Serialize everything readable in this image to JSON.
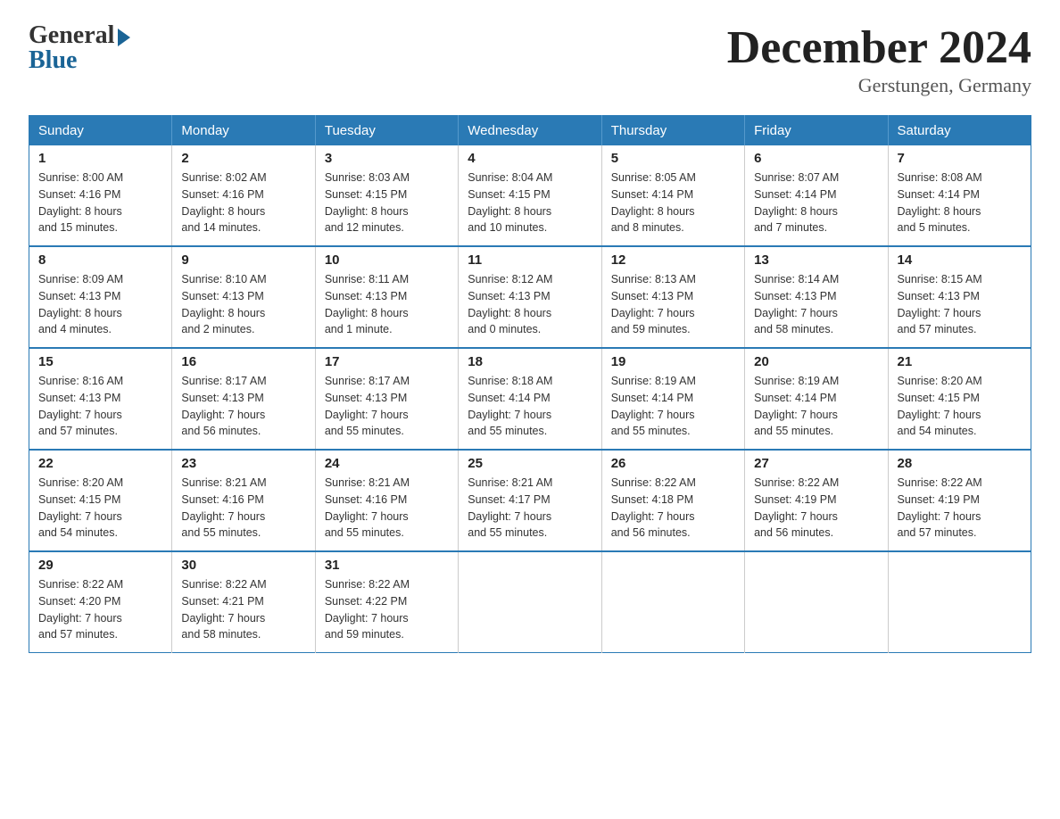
{
  "header": {
    "logo_general": "General",
    "logo_blue": "Blue",
    "month_title": "December 2024",
    "location": "Gerstungen, Germany"
  },
  "days_of_week": [
    "Sunday",
    "Monday",
    "Tuesday",
    "Wednesday",
    "Thursday",
    "Friday",
    "Saturday"
  ],
  "weeks": [
    [
      {
        "day": "1",
        "info": "Sunrise: 8:00 AM\nSunset: 4:16 PM\nDaylight: 8 hours\nand 15 minutes."
      },
      {
        "day": "2",
        "info": "Sunrise: 8:02 AM\nSunset: 4:16 PM\nDaylight: 8 hours\nand 14 minutes."
      },
      {
        "day": "3",
        "info": "Sunrise: 8:03 AM\nSunset: 4:15 PM\nDaylight: 8 hours\nand 12 minutes."
      },
      {
        "day": "4",
        "info": "Sunrise: 8:04 AM\nSunset: 4:15 PM\nDaylight: 8 hours\nand 10 minutes."
      },
      {
        "day": "5",
        "info": "Sunrise: 8:05 AM\nSunset: 4:14 PM\nDaylight: 8 hours\nand 8 minutes."
      },
      {
        "day": "6",
        "info": "Sunrise: 8:07 AM\nSunset: 4:14 PM\nDaylight: 8 hours\nand 7 minutes."
      },
      {
        "day": "7",
        "info": "Sunrise: 8:08 AM\nSunset: 4:14 PM\nDaylight: 8 hours\nand 5 minutes."
      }
    ],
    [
      {
        "day": "8",
        "info": "Sunrise: 8:09 AM\nSunset: 4:13 PM\nDaylight: 8 hours\nand 4 minutes."
      },
      {
        "day": "9",
        "info": "Sunrise: 8:10 AM\nSunset: 4:13 PM\nDaylight: 8 hours\nand 2 minutes."
      },
      {
        "day": "10",
        "info": "Sunrise: 8:11 AM\nSunset: 4:13 PM\nDaylight: 8 hours\nand 1 minute."
      },
      {
        "day": "11",
        "info": "Sunrise: 8:12 AM\nSunset: 4:13 PM\nDaylight: 8 hours\nand 0 minutes."
      },
      {
        "day": "12",
        "info": "Sunrise: 8:13 AM\nSunset: 4:13 PM\nDaylight: 7 hours\nand 59 minutes."
      },
      {
        "day": "13",
        "info": "Sunrise: 8:14 AM\nSunset: 4:13 PM\nDaylight: 7 hours\nand 58 minutes."
      },
      {
        "day": "14",
        "info": "Sunrise: 8:15 AM\nSunset: 4:13 PM\nDaylight: 7 hours\nand 57 minutes."
      }
    ],
    [
      {
        "day": "15",
        "info": "Sunrise: 8:16 AM\nSunset: 4:13 PM\nDaylight: 7 hours\nand 57 minutes."
      },
      {
        "day": "16",
        "info": "Sunrise: 8:17 AM\nSunset: 4:13 PM\nDaylight: 7 hours\nand 56 minutes."
      },
      {
        "day": "17",
        "info": "Sunrise: 8:17 AM\nSunset: 4:13 PM\nDaylight: 7 hours\nand 55 minutes."
      },
      {
        "day": "18",
        "info": "Sunrise: 8:18 AM\nSunset: 4:14 PM\nDaylight: 7 hours\nand 55 minutes."
      },
      {
        "day": "19",
        "info": "Sunrise: 8:19 AM\nSunset: 4:14 PM\nDaylight: 7 hours\nand 55 minutes."
      },
      {
        "day": "20",
        "info": "Sunrise: 8:19 AM\nSunset: 4:14 PM\nDaylight: 7 hours\nand 55 minutes."
      },
      {
        "day": "21",
        "info": "Sunrise: 8:20 AM\nSunset: 4:15 PM\nDaylight: 7 hours\nand 54 minutes."
      }
    ],
    [
      {
        "day": "22",
        "info": "Sunrise: 8:20 AM\nSunset: 4:15 PM\nDaylight: 7 hours\nand 54 minutes."
      },
      {
        "day": "23",
        "info": "Sunrise: 8:21 AM\nSunset: 4:16 PM\nDaylight: 7 hours\nand 55 minutes."
      },
      {
        "day": "24",
        "info": "Sunrise: 8:21 AM\nSunset: 4:16 PM\nDaylight: 7 hours\nand 55 minutes."
      },
      {
        "day": "25",
        "info": "Sunrise: 8:21 AM\nSunset: 4:17 PM\nDaylight: 7 hours\nand 55 minutes."
      },
      {
        "day": "26",
        "info": "Sunrise: 8:22 AM\nSunset: 4:18 PM\nDaylight: 7 hours\nand 56 minutes."
      },
      {
        "day": "27",
        "info": "Sunrise: 8:22 AM\nSunset: 4:19 PM\nDaylight: 7 hours\nand 56 minutes."
      },
      {
        "day": "28",
        "info": "Sunrise: 8:22 AM\nSunset: 4:19 PM\nDaylight: 7 hours\nand 57 minutes."
      }
    ],
    [
      {
        "day": "29",
        "info": "Sunrise: 8:22 AM\nSunset: 4:20 PM\nDaylight: 7 hours\nand 57 minutes."
      },
      {
        "day": "30",
        "info": "Sunrise: 8:22 AM\nSunset: 4:21 PM\nDaylight: 7 hours\nand 58 minutes."
      },
      {
        "day": "31",
        "info": "Sunrise: 8:22 AM\nSunset: 4:22 PM\nDaylight: 7 hours\nand 59 minutes."
      },
      {
        "day": "",
        "info": ""
      },
      {
        "day": "",
        "info": ""
      },
      {
        "day": "",
        "info": ""
      },
      {
        "day": "",
        "info": ""
      }
    ]
  ]
}
